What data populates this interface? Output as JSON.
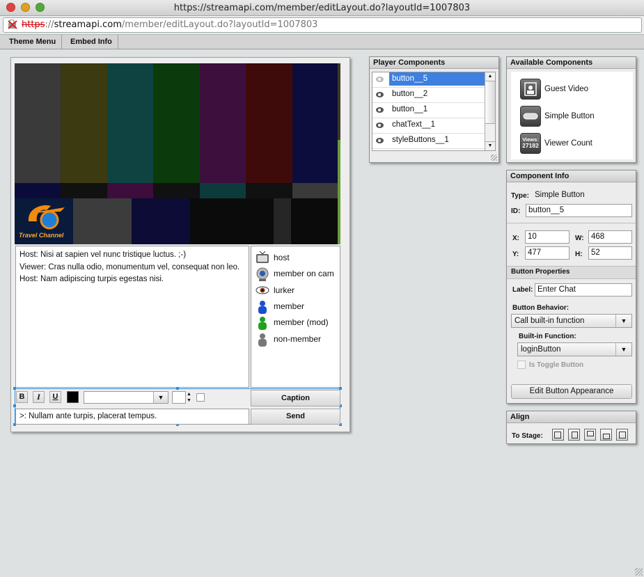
{
  "window": {
    "title": "https://streamapi.com/member/editLayout.do?layoutId=1007803",
    "url_scheme": "https",
    "url_sep": "://",
    "url_host": "streamapi.com",
    "url_path": "/member/editLayout.do?layoutId=1007803"
  },
  "menu": {
    "items": [
      "Theme Menu",
      "Embed Info"
    ]
  },
  "stage": {
    "video_logo": "Travel Channel",
    "chat_lines": [
      "Host: Nisi at sapien vel nunc tristique luctus. ;-)",
      "Viewer: Cras nulla odio, monumentum vel, consequat non leo.",
      "Host: Nam adipiscing turpis egestas nisi."
    ],
    "legend": [
      {
        "label": "host",
        "icon": "tv-icon"
      },
      {
        "label": "member on cam",
        "icon": "webcam-icon"
      },
      {
        "label": "lurker",
        "icon": "eye-icon"
      },
      {
        "label": "member",
        "icon": "user-blue-icon"
      },
      {
        "label": "member (mod)",
        "icon": "user-green-icon"
      },
      {
        "label": "non-member",
        "icon": "user-gray-icon"
      }
    ],
    "toolbar": {
      "bold": "B",
      "italic": "I",
      "underline": "U"
    },
    "caption_button": "Caption",
    "send_button": "Send",
    "input_text": ">: Nullam ante turpis, placerat tempus."
  },
  "player_components": {
    "title": "Player Components",
    "items": [
      "button__5",
      "button__2",
      "button__1",
      "chatText__1",
      "styleButtons__1"
    ]
  },
  "available_components": {
    "title": "Available Components",
    "items": [
      "Guest Video",
      "Simple Button",
      "Viewer Count"
    ],
    "viewer_icon_text": "Views:",
    "viewer_icon_count": "27182"
  },
  "component_info": {
    "title": "Component Info",
    "type_label": "Type:",
    "type_value": "Simple Button",
    "id_label": "ID:",
    "id_value": "button__5",
    "x_label": "X:",
    "x_value": "10",
    "w_label": "W:",
    "w_value": "468",
    "y_label": "Y:",
    "y_value": "477",
    "h_label": "H:",
    "h_value": "52",
    "section_title": "Button Properties",
    "label_label": "Label:",
    "label_value": "Enter Chat",
    "behavior_label": "Button Behavior:",
    "behavior_value": "Call built-in function",
    "builtin_label": "Built-in Function:",
    "builtin_value": "loginButton",
    "toggle_label": "Is Toggle Button",
    "edit_button": "Edit Button Appearance"
  },
  "align": {
    "title": "Align",
    "to_stage_label": "To Stage:"
  },
  "colors": {
    "selection": "#3d80df",
    "stage_bg": "#eeeeee"
  }
}
